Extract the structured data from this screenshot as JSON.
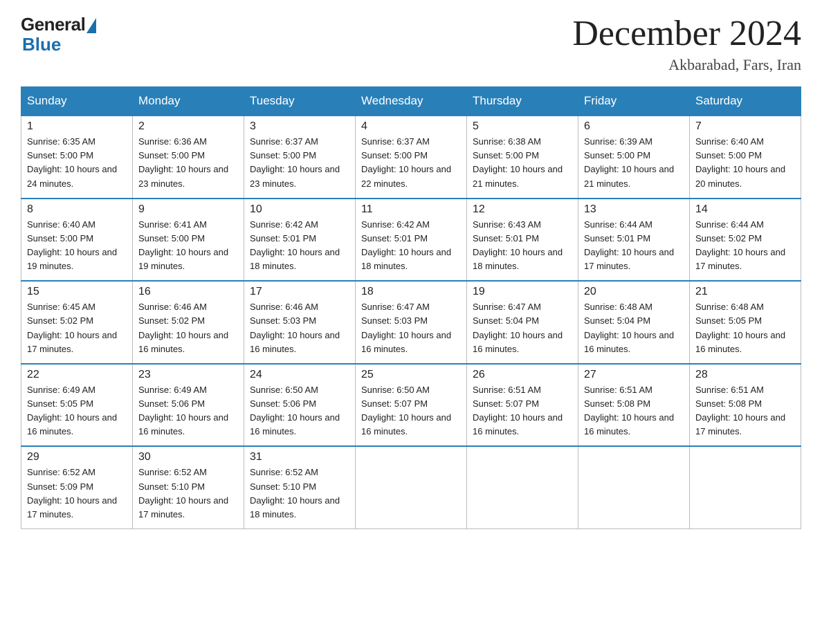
{
  "header": {
    "logo_general": "General",
    "logo_blue": "Blue",
    "title": "December 2024",
    "location": "Akbarabad, Fars, Iran"
  },
  "days_of_week": [
    "Sunday",
    "Monday",
    "Tuesday",
    "Wednesday",
    "Thursday",
    "Friday",
    "Saturday"
  ],
  "weeks": [
    [
      {
        "day": "1",
        "sunrise": "6:35 AM",
        "sunset": "5:00 PM",
        "daylight": "10 hours and 24 minutes."
      },
      {
        "day": "2",
        "sunrise": "6:36 AM",
        "sunset": "5:00 PM",
        "daylight": "10 hours and 23 minutes."
      },
      {
        "day": "3",
        "sunrise": "6:37 AM",
        "sunset": "5:00 PM",
        "daylight": "10 hours and 23 minutes."
      },
      {
        "day": "4",
        "sunrise": "6:37 AM",
        "sunset": "5:00 PM",
        "daylight": "10 hours and 22 minutes."
      },
      {
        "day": "5",
        "sunrise": "6:38 AM",
        "sunset": "5:00 PM",
        "daylight": "10 hours and 21 minutes."
      },
      {
        "day": "6",
        "sunrise": "6:39 AM",
        "sunset": "5:00 PM",
        "daylight": "10 hours and 21 minutes."
      },
      {
        "day": "7",
        "sunrise": "6:40 AM",
        "sunset": "5:00 PM",
        "daylight": "10 hours and 20 minutes."
      }
    ],
    [
      {
        "day": "8",
        "sunrise": "6:40 AM",
        "sunset": "5:00 PM",
        "daylight": "10 hours and 19 minutes."
      },
      {
        "day": "9",
        "sunrise": "6:41 AM",
        "sunset": "5:00 PM",
        "daylight": "10 hours and 19 minutes."
      },
      {
        "day": "10",
        "sunrise": "6:42 AM",
        "sunset": "5:01 PM",
        "daylight": "10 hours and 18 minutes."
      },
      {
        "day": "11",
        "sunrise": "6:42 AM",
        "sunset": "5:01 PM",
        "daylight": "10 hours and 18 minutes."
      },
      {
        "day": "12",
        "sunrise": "6:43 AM",
        "sunset": "5:01 PM",
        "daylight": "10 hours and 18 minutes."
      },
      {
        "day": "13",
        "sunrise": "6:44 AM",
        "sunset": "5:01 PM",
        "daylight": "10 hours and 17 minutes."
      },
      {
        "day": "14",
        "sunrise": "6:44 AM",
        "sunset": "5:02 PM",
        "daylight": "10 hours and 17 minutes."
      }
    ],
    [
      {
        "day": "15",
        "sunrise": "6:45 AM",
        "sunset": "5:02 PM",
        "daylight": "10 hours and 17 minutes."
      },
      {
        "day": "16",
        "sunrise": "6:46 AM",
        "sunset": "5:02 PM",
        "daylight": "10 hours and 16 minutes."
      },
      {
        "day": "17",
        "sunrise": "6:46 AM",
        "sunset": "5:03 PM",
        "daylight": "10 hours and 16 minutes."
      },
      {
        "day": "18",
        "sunrise": "6:47 AM",
        "sunset": "5:03 PM",
        "daylight": "10 hours and 16 minutes."
      },
      {
        "day": "19",
        "sunrise": "6:47 AM",
        "sunset": "5:04 PM",
        "daylight": "10 hours and 16 minutes."
      },
      {
        "day": "20",
        "sunrise": "6:48 AM",
        "sunset": "5:04 PM",
        "daylight": "10 hours and 16 minutes."
      },
      {
        "day": "21",
        "sunrise": "6:48 AM",
        "sunset": "5:05 PM",
        "daylight": "10 hours and 16 minutes."
      }
    ],
    [
      {
        "day": "22",
        "sunrise": "6:49 AM",
        "sunset": "5:05 PM",
        "daylight": "10 hours and 16 minutes."
      },
      {
        "day": "23",
        "sunrise": "6:49 AM",
        "sunset": "5:06 PM",
        "daylight": "10 hours and 16 minutes."
      },
      {
        "day": "24",
        "sunrise": "6:50 AM",
        "sunset": "5:06 PM",
        "daylight": "10 hours and 16 minutes."
      },
      {
        "day": "25",
        "sunrise": "6:50 AM",
        "sunset": "5:07 PM",
        "daylight": "10 hours and 16 minutes."
      },
      {
        "day": "26",
        "sunrise": "6:51 AM",
        "sunset": "5:07 PM",
        "daylight": "10 hours and 16 minutes."
      },
      {
        "day": "27",
        "sunrise": "6:51 AM",
        "sunset": "5:08 PM",
        "daylight": "10 hours and 16 minutes."
      },
      {
        "day": "28",
        "sunrise": "6:51 AM",
        "sunset": "5:08 PM",
        "daylight": "10 hours and 17 minutes."
      }
    ],
    [
      {
        "day": "29",
        "sunrise": "6:52 AM",
        "sunset": "5:09 PM",
        "daylight": "10 hours and 17 minutes."
      },
      {
        "day": "30",
        "sunrise": "6:52 AM",
        "sunset": "5:10 PM",
        "daylight": "10 hours and 17 minutes."
      },
      {
        "day": "31",
        "sunrise": "6:52 AM",
        "sunset": "5:10 PM",
        "daylight": "10 hours and 18 minutes."
      },
      null,
      null,
      null,
      null
    ]
  ]
}
